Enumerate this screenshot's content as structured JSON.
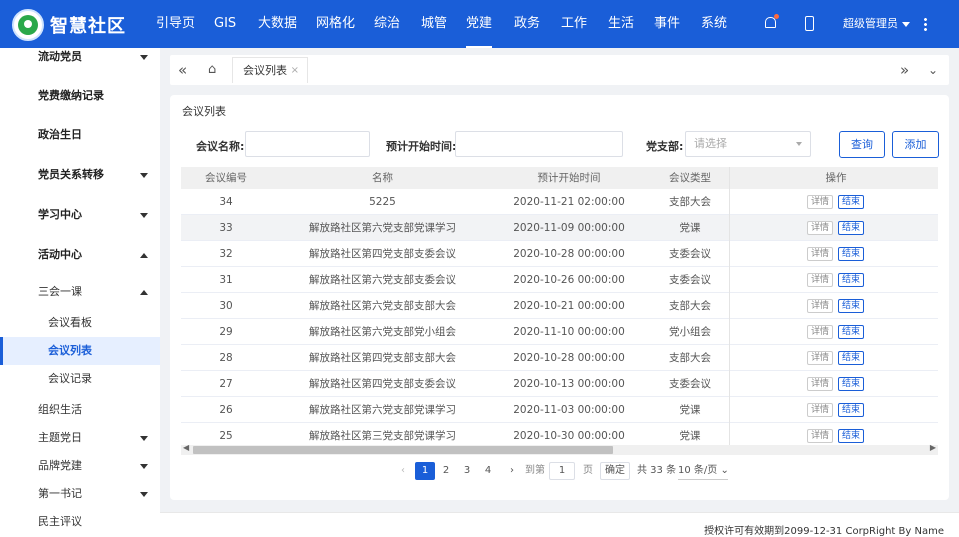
{
  "brand": {
    "title": "智慧社区"
  },
  "nav": [
    {
      "label": "引导页"
    },
    {
      "label": "GIS"
    },
    {
      "label": "大数据"
    },
    {
      "label": "网格化"
    },
    {
      "label": "综治"
    },
    {
      "label": "城管"
    },
    {
      "label": "党建"
    },
    {
      "label": "政务"
    },
    {
      "label": "工作"
    },
    {
      "label": "生活"
    },
    {
      "label": "事件"
    },
    {
      "label": "系统"
    }
  ],
  "nav_active": "党建",
  "user": {
    "name": "超级管理员"
  },
  "sidebar": {
    "items": [
      {
        "label": "流动党员",
        "caret": "down"
      },
      {
        "label": "党费缴纳记录"
      },
      {
        "label": "政治生日"
      },
      {
        "label": "党员关系转移",
        "caret": "down"
      },
      {
        "label": "学习中心",
        "caret": "down"
      },
      {
        "label": "活动中心",
        "caret": "up"
      }
    ],
    "group": {
      "label": "三会一课",
      "caret": "up"
    },
    "sub_items": [
      {
        "label": "会议看板"
      },
      {
        "label": "会议列表",
        "active": true
      },
      {
        "label": "会议记录"
      }
    ],
    "items2": [
      {
        "label": "组织生活"
      },
      {
        "label": "主题党日",
        "caret": "down"
      },
      {
        "label": "品牌党建",
        "caret": "down"
      },
      {
        "label": "第一书记",
        "caret": "down"
      },
      {
        "label": "民主评议"
      }
    ]
  },
  "tabs": {
    "current": "会议列表",
    "close": "×"
  },
  "page": {
    "title": "会议列表",
    "filters": {
      "name_label": "会议名称:",
      "time_label": "预计开始时间:",
      "branch_label": "党支部:",
      "branch_placeholder": "请选择"
    },
    "buttons": {
      "query": "查询",
      "add": "添加"
    }
  },
  "table": {
    "headers": [
      "会议编号",
      "名称",
      "预计开始时间",
      "会议类型",
      "操作"
    ],
    "rows": [
      {
        "id": "34",
        "name": "5225",
        "time": "2020-11-21 02:00:00",
        "type": "支部大会"
      },
      {
        "id": "33",
        "name": "解放路社区第六党支部党课学习",
        "time": "2020-11-09 00:00:00",
        "type": "党课"
      },
      {
        "id": "32",
        "name": "解放路社区第四党支部支委会议",
        "time": "2020-10-28 00:00:00",
        "type": "支委会议"
      },
      {
        "id": "31",
        "name": "解放路社区第六党支部支委会议",
        "time": "2020-10-26 00:00:00",
        "type": "支委会议"
      },
      {
        "id": "30",
        "name": "解放路社区第六党支部支部大会",
        "time": "2020-10-21 00:00:00",
        "type": "支部大会"
      },
      {
        "id": "29",
        "name": "解放路社区第六党支部党小组会",
        "time": "2020-11-10 00:00:00",
        "type": "党小组会"
      },
      {
        "id": "28",
        "name": "解放路社区第四党支部支部大会",
        "time": "2020-10-28 00:00:00",
        "type": "支部大会"
      },
      {
        "id": "27",
        "name": "解放路社区第四党支部支委会议",
        "time": "2020-10-13 00:00:00",
        "type": "支委会议"
      },
      {
        "id": "26",
        "name": "解放路社区第六党支部党课学习",
        "time": "2020-11-03 00:00:00",
        "type": "党课"
      },
      {
        "id": "25",
        "name": "解放路社区第三党支部党课学习",
        "time": "2020-10-30 00:00:00",
        "type": "党课"
      }
    ],
    "highlight_row": 1,
    "ops": {
      "detail": "详情",
      "end": "结束"
    }
  },
  "pager": {
    "pages": [
      "1",
      "2",
      "3",
      "4"
    ],
    "current_page": 1,
    "goto_label": "到第",
    "goto_value": "1",
    "page_unit": "页",
    "confirm": "确定",
    "total": "共 33 条",
    "size": "10 条/页"
  },
  "footer": {
    "text": "授权许可有效期到2099-12-31 CorpRight By Name"
  },
  "colors": {
    "primary": "#1a5ed8",
    "notify_dot": "#ff6a3d",
    "logo_green": "#2aa84a"
  }
}
